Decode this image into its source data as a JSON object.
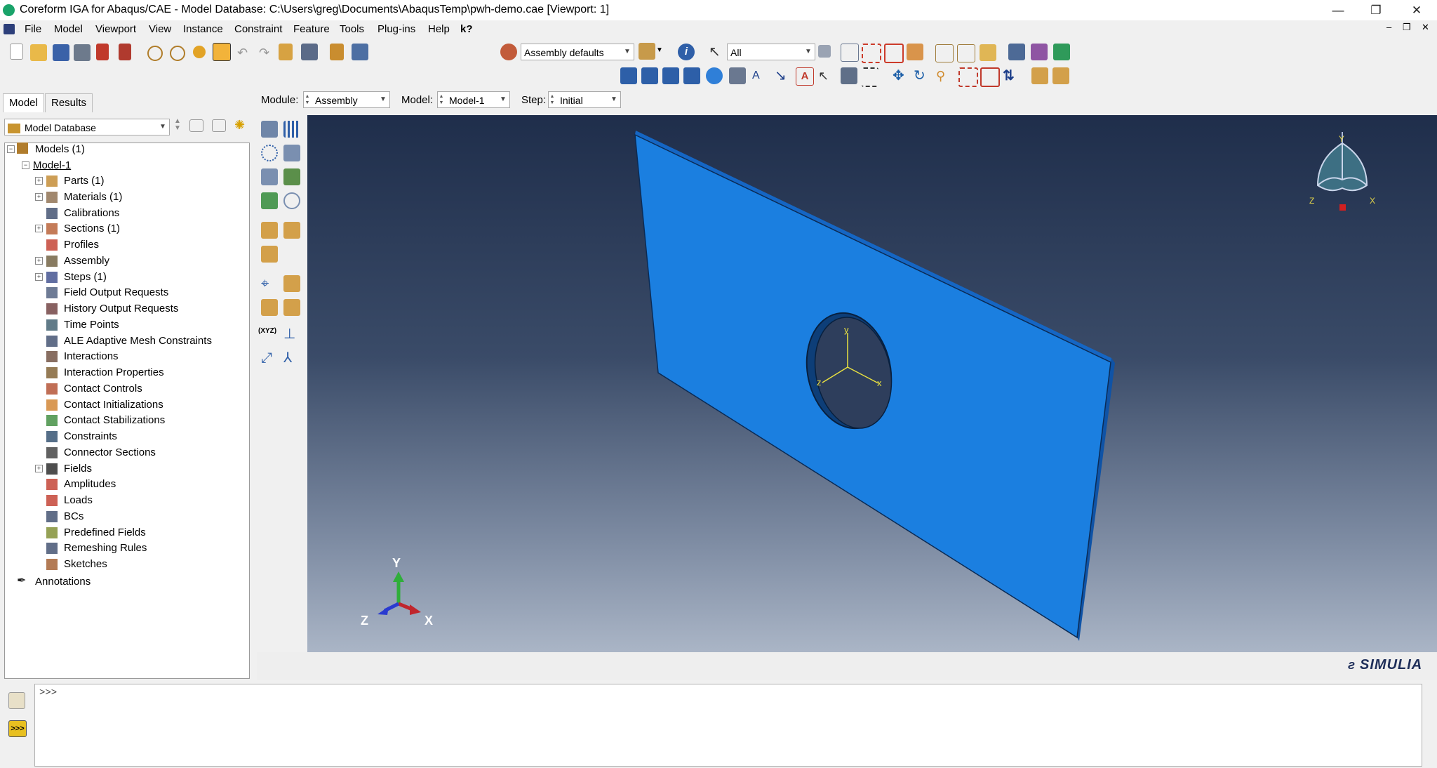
{
  "window": {
    "title": "Coreform IGA for Abaqus/CAE - Model Database: C:\\Users\\greg\\Documents\\AbaqusTemp\\pwh-demo.cae [Viewport: 1]",
    "controls": [
      "—",
      "❐",
      "✕"
    ],
    "mdi_controls": [
      "–",
      "❐",
      "✕"
    ]
  },
  "menu": [
    "File",
    "Model",
    "Viewport",
    "View",
    "Instance",
    "Constraint",
    "Feature",
    "Tools",
    "Plug-ins",
    "Help",
    "k?"
  ],
  "toolbar": {
    "render_style": "Assembly defaults",
    "selection_filter": "All"
  },
  "tabs": [
    "Model",
    "Results"
  ],
  "tree": {
    "database_combo": "Model Database",
    "root": "Models (1)",
    "model": "Model-1",
    "items": [
      {
        "label": "Parts (1)",
        "icon": "parts-icon",
        "expandable": true
      },
      {
        "label": "Materials (1)",
        "icon": "materials-icon",
        "expandable": true
      },
      {
        "label": "Calibrations",
        "icon": "calibrations-icon",
        "expandable": false
      },
      {
        "label": "Sections (1)",
        "icon": "sections-icon",
        "expandable": true
      },
      {
        "label": "Profiles",
        "icon": "profiles-icon",
        "expandable": false
      },
      {
        "label": "Assembly",
        "icon": "assembly-icon",
        "expandable": true
      },
      {
        "label": "Steps (1)",
        "icon": "steps-icon",
        "expandable": true
      },
      {
        "label": "Field Output Requests",
        "icon": "field-output-icon",
        "expandable": false
      },
      {
        "label": "History Output Requests",
        "icon": "history-output-icon",
        "expandable": false
      },
      {
        "label": "Time Points",
        "icon": "time-points-icon",
        "expandable": false
      },
      {
        "label": "ALE Adaptive Mesh Constraints",
        "icon": "ale-icon",
        "expandable": false
      },
      {
        "label": "Interactions",
        "icon": "interactions-icon",
        "expandable": false
      },
      {
        "label": "Interaction Properties",
        "icon": "interaction-properties-icon",
        "expandable": false
      },
      {
        "label": "Contact Controls",
        "icon": "contact-controls-icon",
        "expandable": false
      },
      {
        "label": "Contact Initializations",
        "icon": "contact-initializations-icon",
        "expandable": false
      },
      {
        "label": "Contact Stabilizations",
        "icon": "contact-stabilizations-icon",
        "expandable": false
      },
      {
        "label": "Constraints",
        "icon": "constraints-icon",
        "expandable": false
      },
      {
        "label": "Connector Sections",
        "icon": "connector-sections-icon",
        "expandable": false
      },
      {
        "label": "Fields",
        "icon": "fields-icon",
        "expandable": true
      },
      {
        "label": "Amplitudes",
        "icon": "amplitudes-icon",
        "expandable": false
      },
      {
        "label": "Loads",
        "icon": "loads-icon",
        "expandable": false
      },
      {
        "label": "BCs",
        "icon": "bcs-icon",
        "expandable": false
      },
      {
        "label": "Predefined Fields",
        "icon": "predefined-fields-icon",
        "expandable": false
      },
      {
        "label": "Remeshing Rules",
        "icon": "remeshing-icon",
        "expandable": false
      },
      {
        "label": "Sketches",
        "icon": "sketches-icon",
        "expandable": false
      }
    ],
    "annotations": "Annotations"
  },
  "context": {
    "module_label": "Module:",
    "module": "Assembly",
    "model_label": "Model:",
    "model": "Model-1",
    "step_label": "Step:",
    "step": "Initial"
  },
  "viewport": {
    "triad": {
      "x": "X",
      "y": "Y",
      "z": "Z"
    },
    "csys": {
      "x": "x",
      "y": "y",
      "z": "z"
    },
    "view_cube": {
      "x": "X",
      "y": "Y",
      "z": "Z"
    },
    "plate_color": "#1b7fe0",
    "brand": "SIMULIA",
    "tool_label_xyz": "(XYZ)"
  },
  "command": {
    "prompt": ">>>"
  }
}
